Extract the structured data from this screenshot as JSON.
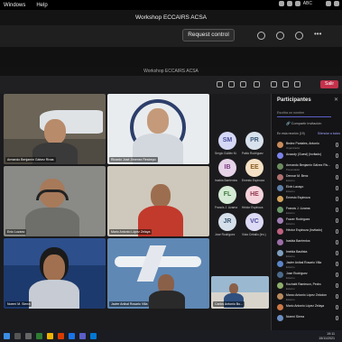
{
  "menubar": {
    "items": [
      "Windows",
      "Help"
    ],
    "abc": "ABC"
  },
  "window_title": "Workshop ECCAIRS ACSA",
  "toolbar": {
    "request_control": "Request control"
  },
  "teams": {
    "title": "Workshop ECCAIRS ACSA",
    "leave": "Salir"
  },
  "tiles": [
    {
      "label": "Armando Benjamín Gálvez Rivas",
      "bg": "#6b6457"
    },
    {
      "label": "Ricardo José Jimenez Restrepo",
      "bg": "#e9ecef"
    },
    {
      "label": "Enio Lozano",
      "bg": "#8a8a86"
    },
    {
      "label": "Mario Antonio López Zelaya",
      "bg": "#cfc8bc"
    },
    {
      "label": "Noemí M. Sierra",
      "bg": "#1d3a6e"
    },
    {
      "label": "Javier Anibal Rosario Villa",
      "bg": "#5f88b5"
    },
    {
      "label": "Carlos Antonio Bo...",
      "bg": "#9ab8d0"
    }
  ],
  "avatars": [
    {
      "initials": "SM",
      "name": "Sergio Guillén M.",
      "bg": "#d5d8f5",
      "fg": "#4b4f99"
    },
    {
      "initials": "PR",
      "name": "Pablo Rodríguez",
      "bg": "#d8e2ec",
      "fg": "#3c5a78"
    },
    {
      "initials": "IB",
      "name": "Irasbia Barrientos",
      "bg": "#e6d3e8",
      "fg": "#7a3d82"
    },
    {
      "initials": "EE",
      "name": "Ernesto Espinoza",
      "bg": "#f4e0c4",
      "fg": "#8a5a1e"
    },
    {
      "initials": "FL",
      "name": "Francis J. Lizama",
      "bg": "#d4ead4",
      "fg": "#3d7a3d"
    },
    {
      "initials": "HE",
      "name": "Héctor Espinoza",
      "bg": "#f5d3dc",
      "fg": "#95394f"
    },
    {
      "initials": "JR",
      "name": "Jose Rodríguez",
      "bg": "#d6e0ea",
      "fg": "#3f5a76"
    },
    {
      "initials": "VC",
      "name": "Viola Ceballo (Inv.)",
      "bg": "#dcdaf4",
      "fg": "#514b9a"
    }
  ],
  "participants": {
    "title": "Participantes",
    "search_placeholder": "Escriba un nombre",
    "share_invite": "Compartir invitación",
    "in_meeting": "En esta reunión (19)",
    "mute_all": "Silenciar a todos",
    "list": [
      {
        "name": "Bedez Paniales, Antonio",
        "role": "Organizador",
        "color": "#c98b5b"
      },
      {
        "name": "Acacoly (Guest) (Invitado)",
        "role": "",
        "color": "#7b83eb"
      },
      {
        "name": "Armando Benjamin Gálvez Riv...",
        "role": "Presentador",
        "color": "#6c8b5e"
      },
      {
        "name": "Dennar M. Benz",
        "role": "Externo",
        "color": "#b07070"
      },
      {
        "name": "Elvin Lacayo",
        "role": "Externo",
        "color": "#5e7fa8"
      },
      {
        "name": "Ernesto Espinoza",
        "role": "",
        "color": "#d6a55c"
      },
      {
        "name": "Francis J. Lizama",
        "role": "Externo",
        "color": "#6a9a6a"
      },
      {
        "name": "Frazer Rodríguez",
        "role": "Externo",
        "color": "#a07fb4"
      },
      {
        "name": "Héctor Espinoza (Invitado)",
        "role": "",
        "color": "#c0617f"
      },
      {
        "name": "Irasbia Barrientos",
        "role": "",
        "color": "#9d6ea7"
      },
      {
        "name": "Imelda Bautista",
        "role": "Externo",
        "color": "#7f9fbf"
      },
      {
        "name": "Javier Anibal Rosario Villa",
        "role": "Externo",
        "color": "#5b85c6"
      },
      {
        "name": "Jose Rodríguez",
        "role": "Externo",
        "color": "#4b6a8a"
      },
      {
        "name": "Kochabi Ramirson, Pedro",
        "role": "Externo",
        "color": "#8fae6b"
      },
      {
        "name": "Marco Antonio López Zelodon",
        "role": "Externo",
        "color": "#b98a5c"
      },
      {
        "name": "Mario Antonio López Zelaya",
        "role": "",
        "color": "#cc7744"
      },
      {
        "name": "Noemí Sierra",
        "role": "",
        "color": "#6b8ec2"
      }
    ]
  },
  "clock": {
    "time": "19:11",
    "date": "15/11/2021"
  }
}
